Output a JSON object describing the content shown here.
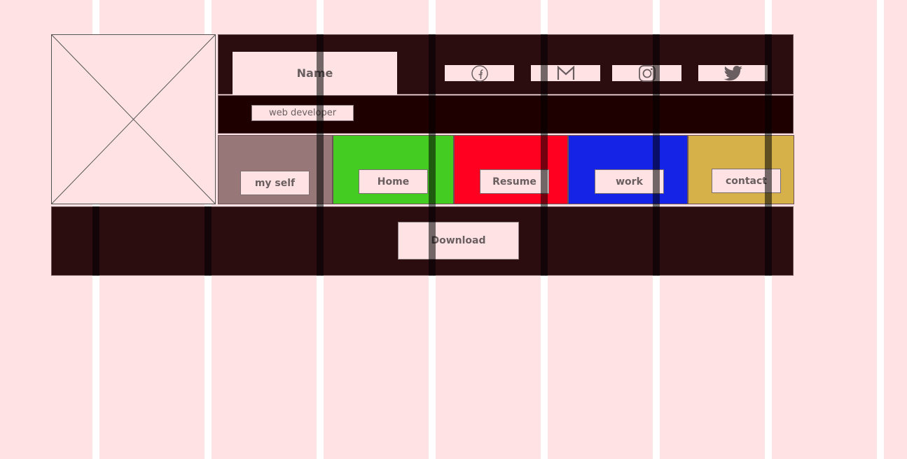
{
  "profile": {
    "name": "Name",
    "role": "web developer",
    "photo_icon": "image-placeholder-icon"
  },
  "social": [
    {
      "id": "facebook",
      "icon": "facebook-icon"
    },
    {
      "id": "gmail",
      "icon": "gmail-icon"
    },
    {
      "id": "instagram",
      "icon": "instagram-icon"
    },
    {
      "id": "twitter",
      "icon": "twitter-icon"
    }
  ],
  "nav": [
    {
      "label": "my self",
      "color": "#987779"
    },
    {
      "label": "Home",
      "color": "#45cc22"
    },
    {
      "label": "Resume",
      "color": "#ff0021"
    },
    {
      "label": "work",
      "color": "#1523e6"
    },
    {
      "label": "contact",
      "color": "#d6b14a"
    }
  ],
  "footer": {
    "download_label": "Download"
  },
  "colors": {
    "background": "#ffe3e4",
    "header": "#2b0d10",
    "subheader": "#1f0000",
    "text": "#6a5e61"
  }
}
